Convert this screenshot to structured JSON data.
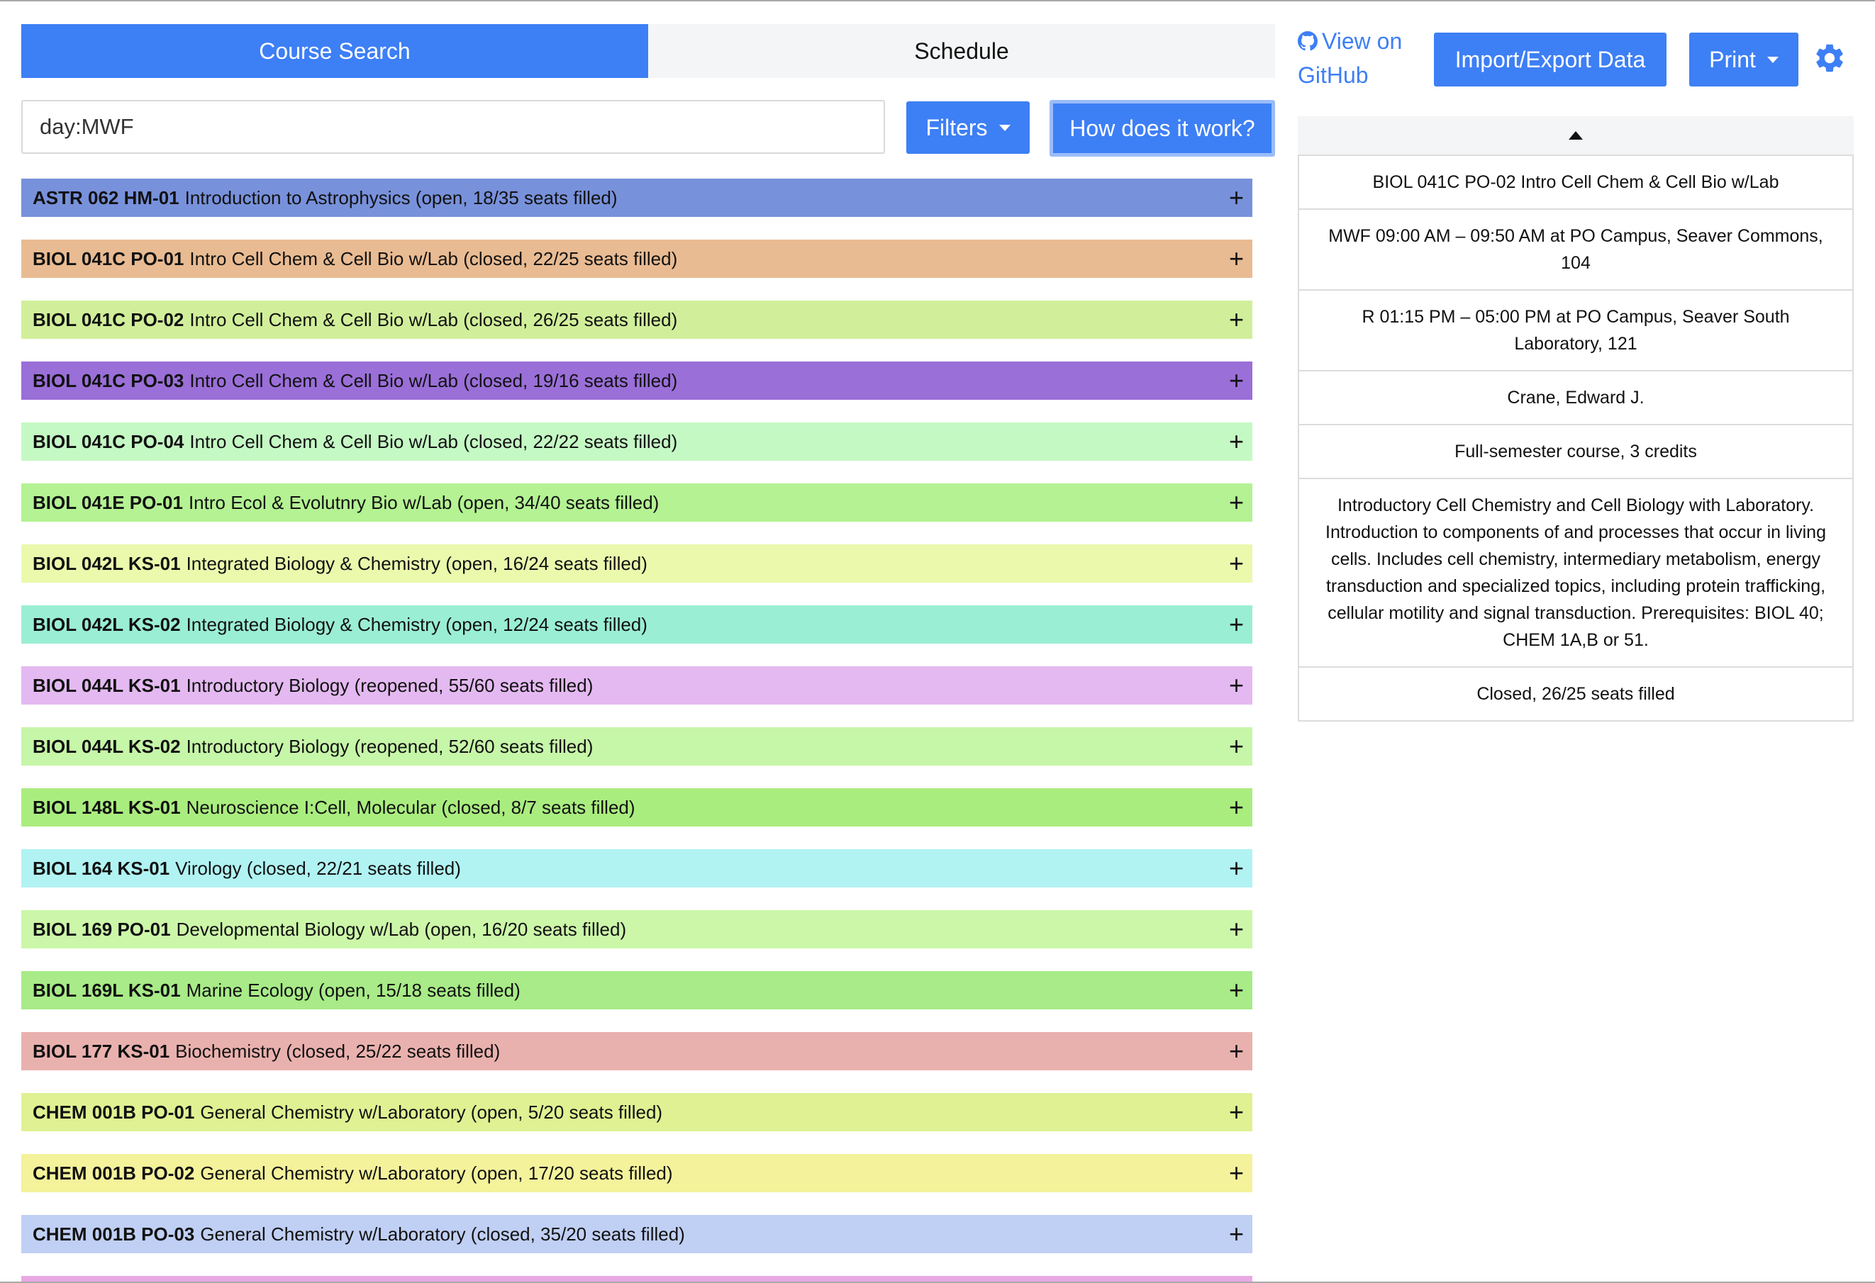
{
  "tabs": {
    "course_search": "Course Search",
    "schedule": "Schedule"
  },
  "search": {
    "value": "day:MWF"
  },
  "buttons": {
    "filters": "Filters",
    "how": "How does it work?",
    "github": "View on GitHub",
    "import_export": "Import/Export Data",
    "print": "Print"
  },
  "colors": {
    "accent": "#3d7ff5"
  },
  "icons": {
    "github": "github-icon",
    "gear": "gear-icon",
    "plus": "plus-icon",
    "caret_up": "caret-up-icon",
    "caret_down": "caret-down-icon"
  },
  "courses": [
    {
      "code": "ASTR 062 HM-01",
      "desc": "Introduction to Astrophysics (open, 18/35 seats filled)",
      "color": "#7891db"
    },
    {
      "code": "BIOL 041C PO-01",
      "desc": "Intro Cell Chem & Cell Bio w/Lab (closed, 22/25 seats filled)",
      "color": "#e9bb92"
    },
    {
      "code": "BIOL 041C PO-02",
      "desc": "Intro Cell Chem & Cell Bio w/Lab (closed, 26/25 seats filled)",
      "color": "#d1ef9a"
    },
    {
      "code": "BIOL 041C PO-03",
      "desc": "Intro Cell Chem & Cell Bio w/Lab (closed, 19/16 seats filled)",
      "color": "#9a6fd8"
    },
    {
      "code": "BIOL 041C PO-04",
      "desc": "Intro Cell Chem & Cell Bio w/Lab (closed, 22/22 seats filled)",
      "color": "#c5f9c4"
    },
    {
      "code": "BIOL 041E PO-01",
      "desc": "Intro Ecol & Evolutnry Bio w/Lab (open, 34/40 seats filled)",
      "color": "#b4f293"
    },
    {
      "code": "BIOL 042L KS-01",
      "desc": "Integrated Biology & Chemistry (open, 16/24 seats filled)",
      "color": "#eaf9ac"
    },
    {
      "code": "BIOL 042L KS-02",
      "desc": "Integrated Biology & Chemistry (open, 12/24 seats filled)",
      "color": "#9aeed4"
    },
    {
      "code": "BIOL 044L KS-01",
      "desc": "Introductory Biology (reopened, 55/60 seats filled)",
      "color": "#e4b9f1"
    },
    {
      "code": "BIOL 044L KS-02",
      "desc": "Introductory Biology (reopened, 52/60 seats filled)",
      "color": "#c6f6a8"
    },
    {
      "code": "BIOL 148L KS-01",
      "desc": "Neuroscience I:Cell, Molecular (closed, 8/7 seats filled)",
      "color": "#aaed7f"
    },
    {
      "code": "BIOL 164 KS-01",
      "desc": "Virology (closed, 22/21 seats filled)",
      "color": "#b1f3f3"
    },
    {
      "code": "BIOL 169 PO-01",
      "desc": "Developmental Biology w/Lab (open, 16/20 seats filled)",
      "color": "#ccf7a9"
    },
    {
      "code": "BIOL 169L KS-01",
      "desc": "Marine Ecology (open, 15/18 seats filled)",
      "color": "#a8eb88"
    },
    {
      "code": "BIOL 177 KS-01",
      "desc": "Biochemistry (closed, 25/22 seats filled)",
      "color": "#e9b1ae"
    },
    {
      "code": "CHEM 001B PO-01",
      "desc": "General Chemistry w/Laboratory (open, 5/20 seats filled)",
      "color": "#dff192"
    },
    {
      "code": "CHEM 001B PO-02",
      "desc": "General Chemistry w/Laboratory (open, 17/20 seats filled)",
      "color": "#f4f29b"
    },
    {
      "code": "CHEM 001B PO-03",
      "desc": "General Chemistry w/Laboratory (closed, 35/20 seats filled)",
      "color": "#c0cff4"
    },
    {
      "code": "",
      "desc": "",
      "color": "#e9a9e4"
    }
  ],
  "detail": {
    "title": "BIOL 041C PO-02 Intro Cell Chem & Cell Bio w/Lab",
    "meeting1": "MWF 09:00 AM – 09:50 AM at PO Campus, Seaver Commons, 104",
    "meeting2": "R 01:15 PM – 05:00 PM at PO Campus, Seaver South Laboratory, 121",
    "instructor": "Crane, Edward J.",
    "credits": "Full-semester course, 3 credits",
    "description": "Introductory Cell Chemistry and Cell Biology with Laboratory. Introduction to components of and processes that occur in living cells. Includes cell chemistry, intermediary metabolism, energy transduction and specialized topics, including protein trafficking, cellular motility and signal transduction. Prerequisites: BIOL 40; CHEM 1A,B or 51.",
    "status": "Closed, 26/25 seats filled"
  }
}
